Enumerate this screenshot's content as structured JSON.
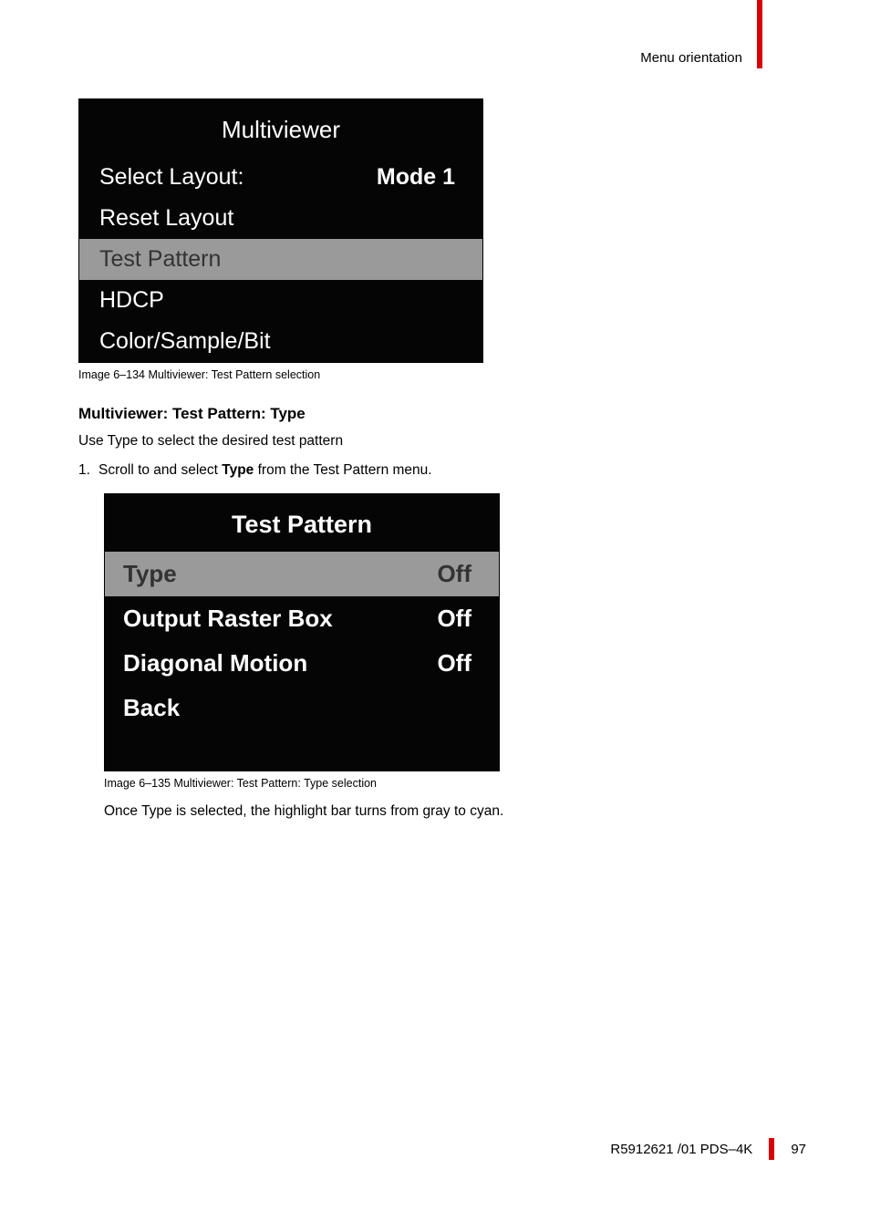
{
  "header": {
    "right_label": "Menu orientation"
  },
  "box1": {
    "title": "Multiviewer",
    "rows": [
      {
        "label": "Select Layout:",
        "value": "Mode 1",
        "selected": false
      },
      {
        "label": "Reset Layout",
        "value": "",
        "selected": false
      },
      {
        "label": "Test Pattern",
        "value": "",
        "selected": true
      },
      {
        "label": "HDCP",
        "value": "",
        "selected": false
      },
      {
        "label": "Color/Sample/Bit",
        "value": "",
        "selected": false
      }
    ],
    "caption": "Image 6–134  Multiviewer: Test Pattern selection"
  },
  "section": {
    "heading": "Multiviewer: Test Pattern: Type",
    "body": "Use Type to select the desired test pattern",
    "step_num": "1.",
    "step_a": "Scroll to and select ",
    "step_b": "Type",
    "step_c": " from the Test Pattern menu."
  },
  "box2": {
    "title": "Test Pattern",
    "rows": [
      {
        "label": "Type",
        "value": "Off",
        "selected": true
      },
      {
        "label": "Output Raster Box",
        "value": "Off",
        "selected": false
      },
      {
        "label": "Diagonal Motion",
        "value": "Off",
        "selected": false
      },
      {
        "label": "Back",
        "value": "",
        "selected": false
      }
    ],
    "caption": "Image 6–135  Multiviewer: Test Pattern: Type selection"
  },
  "after_box2": "Once Type is selected, the highlight bar turns from gray to cyan.",
  "footer": {
    "doc": "R5912621 /01 PDS–4K",
    "page": "97"
  }
}
